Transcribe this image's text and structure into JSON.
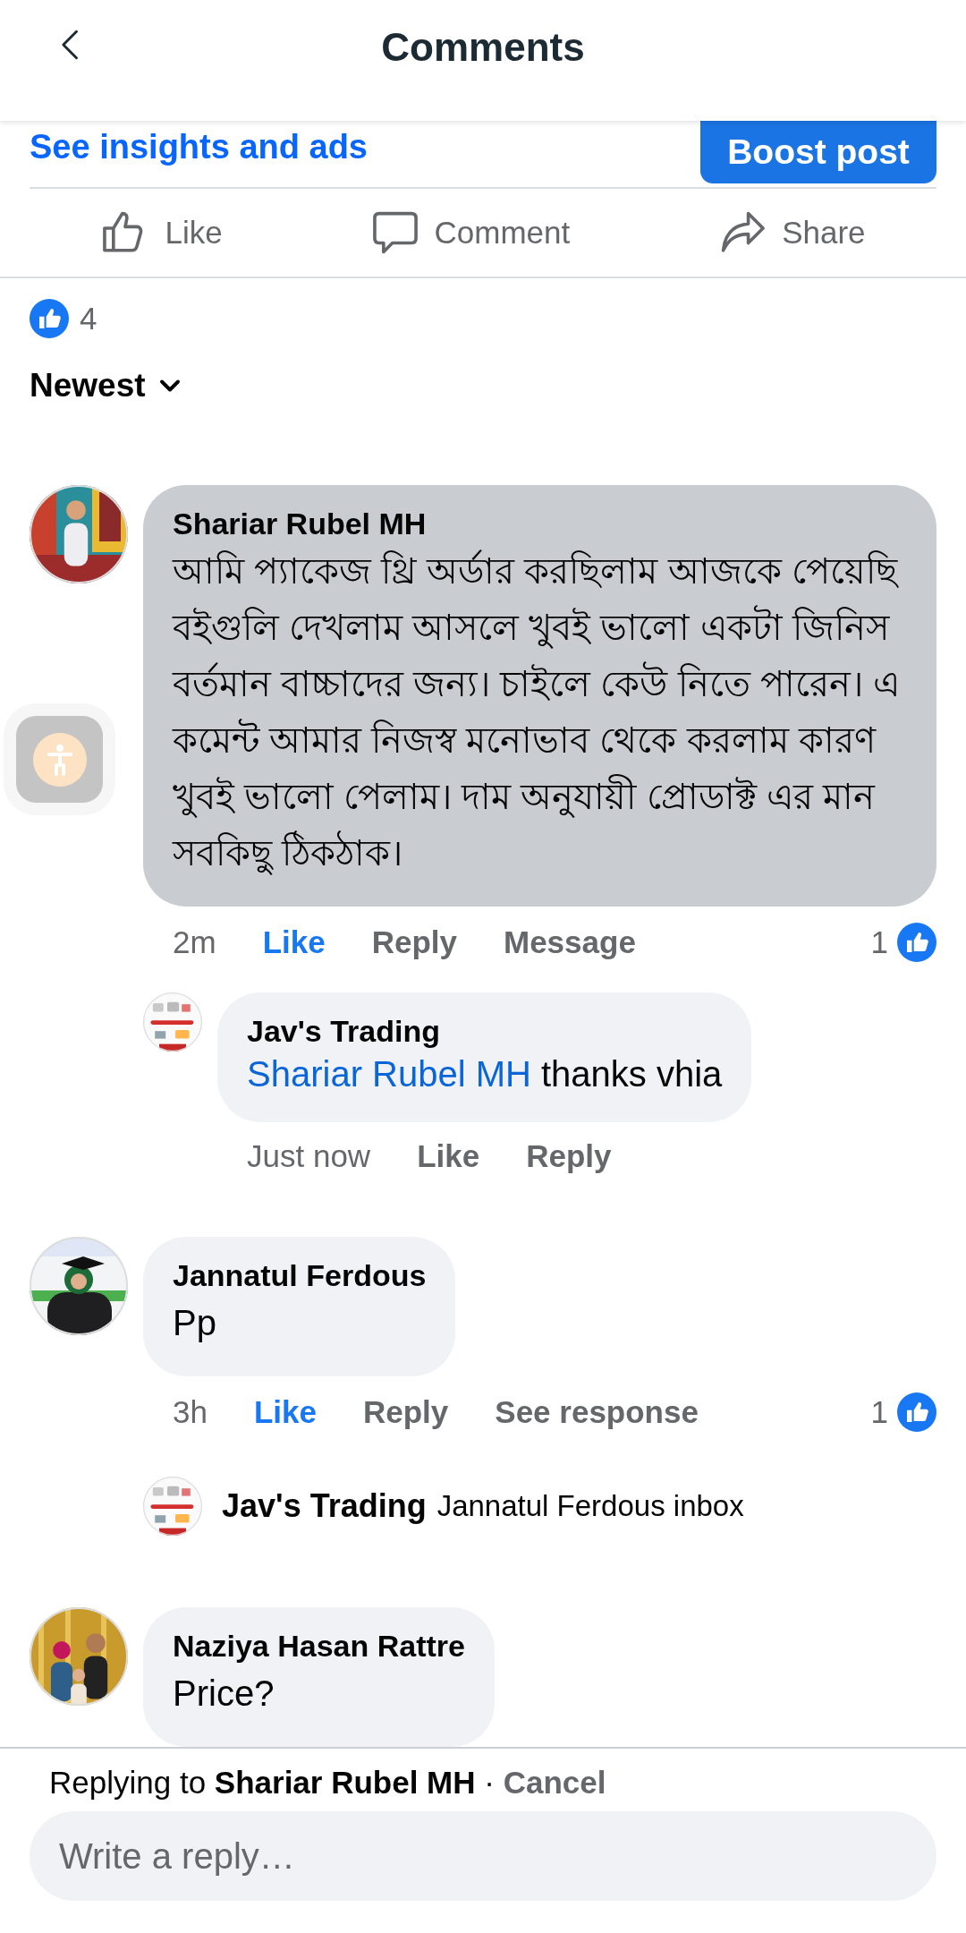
{
  "header": {
    "title": "Comments"
  },
  "insights": {
    "link": "See insights and ads",
    "button": "Boost post"
  },
  "post_actions": [
    {
      "kind": "like",
      "label": "Like"
    },
    {
      "kind": "comment",
      "label": "Comment"
    },
    {
      "kind": "share",
      "label": "Share"
    }
  ],
  "reaction_count": "4",
  "sort": {
    "label": "Newest"
  },
  "comments": [
    {
      "name": "Shariar Rubel MH",
      "text": "আমি প্যাকেজ থ্রি অর্ডার করছিলাম আজকে পেয়েছি বইগুলি দেখলাম আসলে খুবই ভালো একটা জিনিস বর্তমান বাচ্চাদের জন্য। চাইলে কেউ নিতে পারেন। এ কমেন্ট আমার নিজস্ব মনোভাব থেকে করলাম কারণ খুবই ভালো পেলাম। দাম অনুযায়ী প্রোডাক্ট এর মান সবকিছু ঠিকঠাক।",
      "highlighted": true,
      "time": "2m",
      "like": {
        "label": "Like",
        "selected": true
      },
      "reply": "Reply",
      "extra": "Message",
      "reactions": "1",
      "replies": [
        {
          "kind": "full",
          "name": "Jav's Trading",
          "mention": "Shariar Rubel MH",
          "text": "thanks vhia",
          "time": "Just now",
          "like": {
            "label": "Like",
            "selected": false
          },
          "reply": "Reply"
        }
      ]
    },
    {
      "name": "Jannatul Ferdous",
      "text": "Pp",
      "highlighted": false,
      "time": "3h",
      "like": {
        "label": "Like",
        "selected": true
      },
      "reply": "Reply",
      "extra": "See response",
      "reactions": "1",
      "replies": [
        {
          "kind": "preview",
          "name": "Jav's Trading",
          "text": "Jannatul Ferdous inbox"
        }
      ]
    },
    {
      "name": "Naziya Hasan Rattre",
      "text": "Price?",
      "highlighted": false
    }
  ],
  "composer": {
    "prefix": "Replying to",
    "target": "Shariar Rubel MH",
    "separator": "·",
    "cancel": "Cancel",
    "placeholder": "Write a reply…"
  }
}
